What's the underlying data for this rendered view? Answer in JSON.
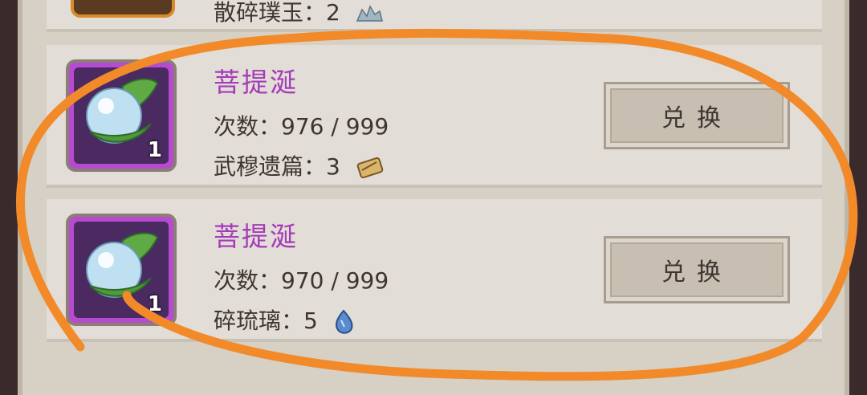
{
  "top_card": {
    "cost_label": "散碎璞玉：",
    "cost_value": "2",
    "cost_icon": "jade-shards-icon"
  },
  "items": [
    {
      "title": "菩提涎",
      "count_badge": "1",
      "times_label": "次数：",
      "times_value": "976 / 999",
      "cost_label": "武穆遗篇：",
      "cost_value": "3",
      "cost_icon": "scroll-icon",
      "button_label": "兑换"
    },
    {
      "title": "菩提涎",
      "count_badge": "1",
      "times_label": "次数：",
      "times_value": "970 / 999",
      "cost_label": "碎琉璃：",
      "cost_value": "5",
      "cost_icon": "glass-shard-icon",
      "button_label": "兑换"
    }
  ],
  "colors": {
    "annotation": "#f28a2a",
    "title": "#a43bb8",
    "icon_border": "#b64bd1"
  }
}
